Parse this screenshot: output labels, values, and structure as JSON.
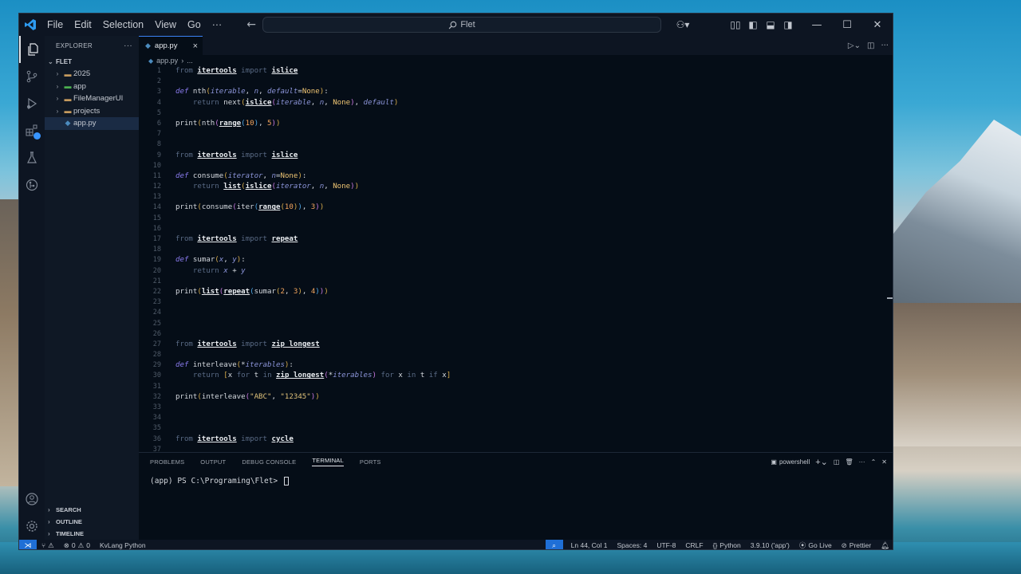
{
  "menu": [
    "File",
    "Edit",
    "Selection",
    "View",
    "Go",
    "···"
  ],
  "search": {
    "label": "Flet"
  },
  "explorer": {
    "title": "EXPLORER",
    "more": "···",
    "folder": "FLET",
    "items": [
      {
        "name": "2025",
        "type": "folder"
      },
      {
        "name": "app",
        "type": "folder-py"
      },
      {
        "name": "FileManagerUI",
        "type": "folder"
      },
      {
        "name": "projects",
        "type": "folder"
      },
      {
        "name": "app.py",
        "type": "python"
      }
    ]
  },
  "sidebar_sections": [
    "SEARCH",
    "OUTLINE",
    "TIMELINE"
  ],
  "tab": {
    "label": "app.py",
    "close": "×"
  },
  "breadcrumb": {
    "file": "app.py",
    "rest": "..."
  },
  "code_lines": [
    {
      "n": "1",
      "html": "<span class=\"kw\">from</span> <span class=\"mod\">itertools</span> <span class=\"kw\">import</span> <span class=\"mod\">islice</span>"
    },
    {
      "n": "2",
      "html": ""
    },
    {
      "n": "3",
      "html": "<span class=\"kwi\">def</span> <span class=\"fn\">nth</span><span class=\"br1\">(</span><span class=\"prm\">iterable</span>, <span class=\"prm\">n</span>, <span class=\"prm\">default</span>=<span class=\"none\">None</span><span class=\"br1\">)</span>:"
    },
    {
      "n": "4",
      "html": "    <span class=\"kw\">return</span> <span class=\"fn\">next</span><span class=\"br1\">(</span><span class=\"mod\">islice</span><span class=\"br2\">(</span><span class=\"prm\">iterable</span>, <span class=\"prm\">n</span>, <span class=\"none\">None</span><span class=\"br2\">)</span>, <span class=\"prm\">default</span><span class=\"br1\">)</span>"
    },
    {
      "n": "5",
      "html": ""
    },
    {
      "n": "6",
      "html": "<span class=\"fn\">print</span><span class=\"br1\">(</span><span class=\"fn\">nth</span><span class=\"br2\">(</span><span class=\"mod\">range</span><span class=\"br3\">(</span><span class=\"num\">10</span><span class=\"br3\">)</span>, <span class=\"num\">5</span><span class=\"br2\">)</span><span class=\"br1\">)</span>"
    },
    {
      "n": "7",
      "html": ""
    },
    {
      "n": "8",
      "html": ""
    },
    {
      "n": "9",
      "html": "<span class=\"kw\">from</span> <span class=\"mod\">itertools</span> <span class=\"kw\">import</span> <span class=\"mod\">islice</span>"
    },
    {
      "n": "10",
      "html": ""
    },
    {
      "n": "11",
      "html": "<span class=\"kwi\">def</span> <span class=\"fn\">consume</span><span class=\"br1\">(</span><span class=\"prm\">iterator</span>, <span class=\"prm\">n</span>=<span class=\"none\">None</span><span class=\"br1\">)</span>:"
    },
    {
      "n": "12",
      "html": "    <span class=\"kw\">return</span> <span class=\"mod\">list</span><span class=\"br1\">(</span><span class=\"mod\">islice</span><span class=\"br2\">(</span><span class=\"prm\">iterator</span>, <span class=\"prm\">n</span>, <span class=\"none\">None</span><span class=\"br2\">)</span><span class=\"br1\">)</span>"
    },
    {
      "n": "13",
      "html": ""
    },
    {
      "n": "14",
      "html": "<span class=\"fn\">print</span><span class=\"br1\">(</span><span class=\"fn\">consume</span><span class=\"br2\">(</span><span class=\"fn\">iter</span><span class=\"br3\">(</span><span class=\"mod\">range</span><span class=\"br1\">(</span><span class=\"num\">10</span><span class=\"br1\">)</span><span class=\"br3\">)</span>, <span class=\"num\">3</span><span class=\"br2\">)</span><span class=\"br1\">)</span>"
    },
    {
      "n": "15",
      "html": ""
    },
    {
      "n": "16",
      "html": ""
    },
    {
      "n": "17",
      "html": "<span class=\"kw\">from</span> <span class=\"mod\">itertools</span> <span class=\"kw\">import</span> <span class=\"mod\">repeat</span>"
    },
    {
      "n": "18",
      "html": ""
    },
    {
      "n": "19",
      "html": "<span class=\"kwi\">def</span> <span class=\"fn\">sumar</span><span class=\"br1\">(</span><span class=\"prm\">x</span>, <span class=\"prm\">y</span><span class=\"br1\">)</span>:"
    },
    {
      "n": "20",
      "html": "    <span class=\"kw\">return</span> <span class=\"prm\">x</span> + <span class=\"prm\">y</span>"
    },
    {
      "n": "21",
      "html": ""
    },
    {
      "n": "22",
      "html": "<span class=\"fn\">print</span><span class=\"br1\">(</span><span class=\"mod\">list</span><span class=\"br2\">(</span><span class=\"mod\">repeat</span><span class=\"br3\">(</span><span class=\"fn\">sumar</span><span class=\"br1\">(</span><span class=\"num\">2</span>, <span class=\"num\">3</span><span class=\"br1\">)</span>, <span class=\"num\">4</span><span class=\"br3\">)</span><span class=\"br2\">)</span><span class=\"br1\">)</span>"
    },
    {
      "n": "23",
      "html": ""
    },
    {
      "n": "24",
      "html": ""
    },
    {
      "n": "25",
      "html": ""
    },
    {
      "n": "26",
      "html": ""
    },
    {
      "n": "27",
      "html": "<span class=\"kw\">from</span> <span class=\"mod\">itertools</span> <span class=\"kw\">import</span> <span class=\"mod\">zip_longest</span>"
    },
    {
      "n": "28",
      "html": ""
    },
    {
      "n": "29",
      "html": "<span class=\"kwi\">def</span> <span class=\"fn\">interleave</span><span class=\"br1\">(</span>*<span class=\"prm\">iterables</span><span class=\"br1\">)</span>:"
    },
    {
      "n": "30",
      "html": "    <span class=\"kw\">return</span> <span class=\"br1\">[</span><span class=\"fn\">x</span> <span class=\"kw\">for</span> <span class=\"fn\">t</span> <span class=\"kw\">in</span> <span class=\"mod\">zip_longest</span><span class=\"br2\">(</span>*<span class=\"prm\">iterables</span><span class=\"br2\">)</span> <span class=\"kw\">for</span> <span class=\"fn\">x</span> <span class=\"kw\">in</span> <span class=\"fn\">t</span> <span class=\"kw\">if</span> <span class=\"fn\">x</span><span class=\"br1\">]</span>"
    },
    {
      "n": "31",
      "html": ""
    },
    {
      "n": "32",
      "html": "<span class=\"fn\">print</span><span class=\"br1\">(</span><span class=\"fn\">interleave</span><span class=\"br2\">(</span><span class=\"str\">\"ABC\"</span>, <span class=\"str\">\"12345\"</span><span class=\"br2\">)</span><span class=\"br1\">)</span>"
    },
    {
      "n": "33",
      "html": ""
    },
    {
      "n": "34",
      "html": ""
    },
    {
      "n": "35",
      "html": ""
    },
    {
      "n": "36",
      "html": "<span class=\"kw\">from</span> <span class=\"mod\">itertools</span> <span class=\"kw\">import</span> <span class=\"mod\">cycle</span>"
    },
    {
      "n": "37",
      "html": ""
    }
  ],
  "panel": {
    "tabs": [
      "PROBLEMS",
      "OUTPUT",
      "DEBUG CONSOLE",
      "TERMINAL",
      "PORTS"
    ],
    "active_tab": "TERMINAL",
    "shell": "powershell",
    "prompt": "(app) PS C:\\Programing\\Flet> "
  },
  "status": {
    "errors": "0",
    "warnings": "0",
    "language_mode": "KvLang Python",
    "cursor": "Ln 44, Col 1",
    "spaces": "Spaces: 4",
    "encoding": "UTF-8",
    "eol": "CRLF",
    "language": "Python",
    "interpreter": "3.9.10 ('app')",
    "golive": "Go Live",
    "prettier": "Prettier"
  }
}
